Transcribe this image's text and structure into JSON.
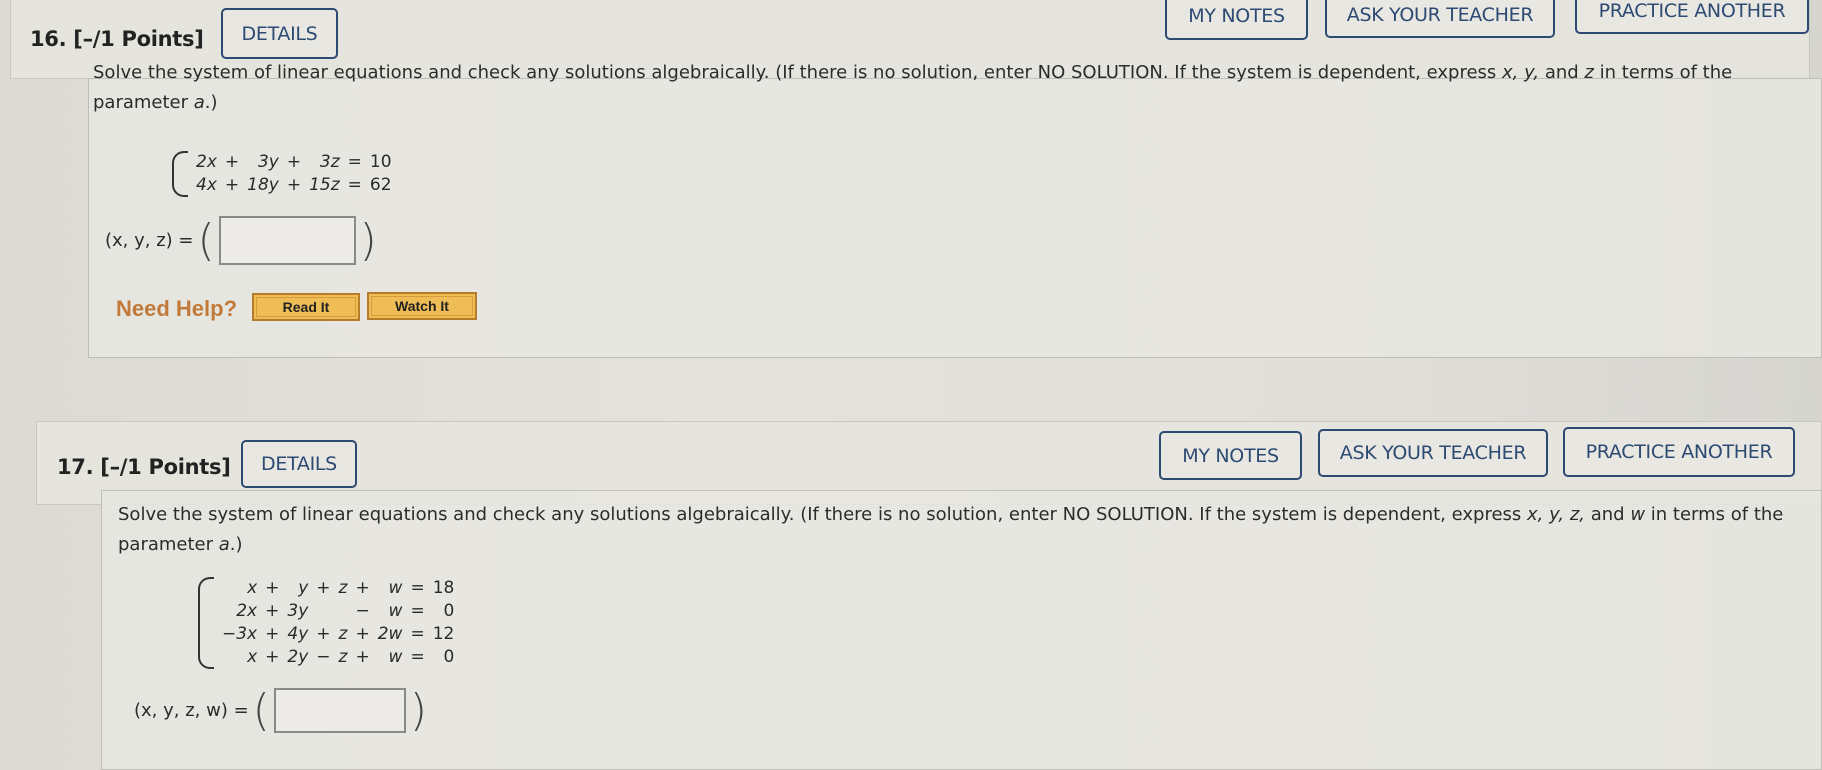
{
  "questions": [
    {
      "number_label": "16. [–/1 Points]",
      "details_label": "DETAILS",
      "my_notes_label": "MY NOTES",
      "ask_teacher_label": "ASK YOUR TEACHER",
      "practice_label": "PRACTICE ANOTHER",
      "prompt_line1_a": "Solve the system of linear equations and check any solutions algebraically. (If there is no solution, enter NO SOLUTION. If the system is dependent, express ",
      "prompt_vars": "x, y,",
      "prompt_line1_b": " and ",
      "prompt_last_var": "z",
      "prompt_line1_c": " in terms of the",
      "prompt_line2_a": "parameter ",
      "prompt_param": "a",
      "prompt_line2_b": ".)",
      "equations": [
        [
          "2x",
          "+",
          "3y",
          "+",
          "3z",
          "=",
          "10"
        ],
        [
          "4x",
          "+",
          "18y",
          "+",
          "15z",
          "=",
          "62"
        ]
      ],
      "answer_label": "(x, y, z) =",
      "answer_value": "",
      "need_help_label": "Need Help?",
      "read_it_label": "Read It",
      "watch_it_label": "Watch It"
    },
    {
      "number_label": "17. [–/1 Points]",
      "details_label": "DETAILS",
      "my_notes_label": "MY NOTES",
      "ask_teacher_label": "ASK YOUR TEACHER",
      "practice_label": "PRACTICE ANOTHER",
      "prompt_line1_a": "Solve the system of linear equations and check any solutions algebraically. (If there is no solution, enter NO SOLUTION. If the system is dependent, express ",
      "prompt_vars": "x, y, z,",
      "prompt_line1_b": " and ",
      "prompt_last_var": "w",
      "prompt_line1_c": " in terms of the",
      "prompt_line2_a": "parameter ",
      "prompt_param": "a",
      "prompt_line2_b": ".)",
      "equations": [
        [
          "x",
          "+",
          "y",
          "+",
          "z",
          "+",
          "w",
          "=",
          "18"
        ],
        [
          "2x",
          "+",
          "3y",
          "",
          "",
          "−",
          "w",
          "=",
          "0"
        ],
        [
          "−3x",
          "+",
          "4y",
          "+",
          "z",
          "+",
          "2w",
          "=",
          "12"
        ],
        [
          "x",
          "+",
          "2y",
          "−",
          "z",
          "+",
          "w",
          "=",
          "0"
        ]
      ],
      "answer_label": "(x, y, z, w) =",
      "answer_value": ""
    }
  ]
}
